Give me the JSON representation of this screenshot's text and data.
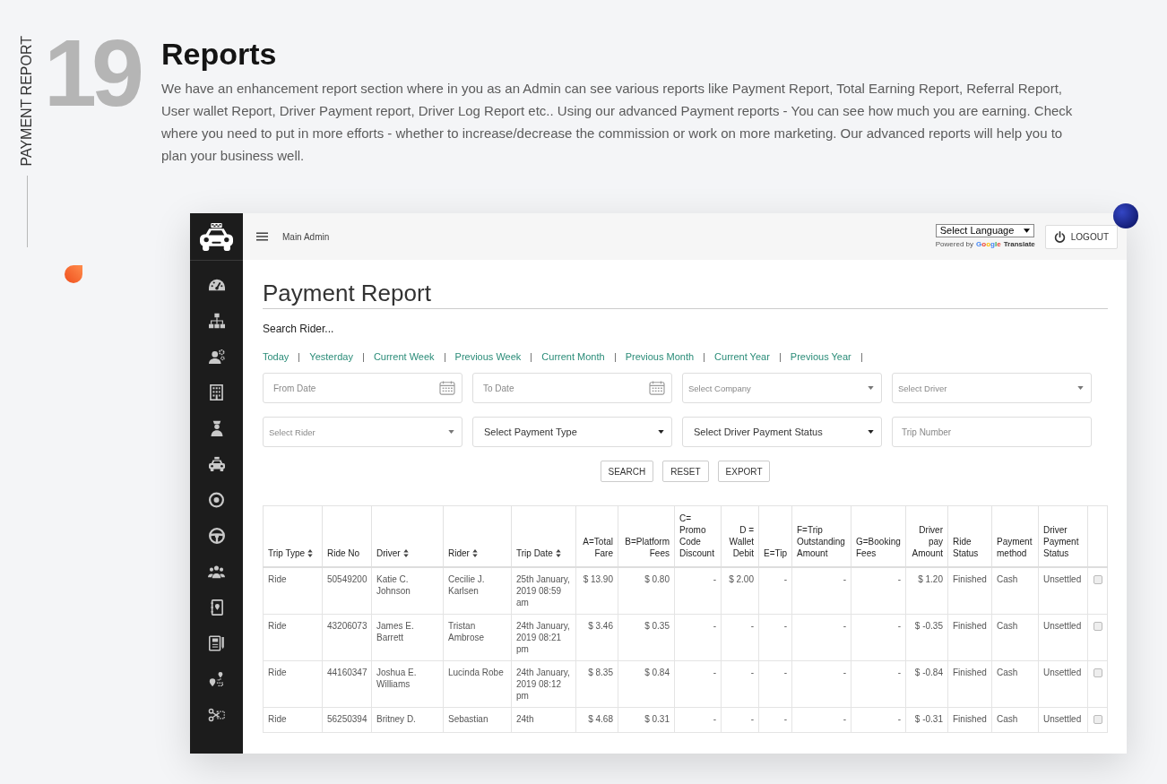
{
  "side_label": "PAYMENT REPORT",
  "section_number": "19",
  "title": "Reports",
  "description": "We have an enhancement report section where in you as an Admin can see various reports like Payment Report, Total Earning Report, Referral Report, User wallet Report, Driver Payment report, Driver Log Report etc.. Using our advanced Payment reports - You can see how much you are earning. Check where you need to put in more efforts - whether to increase/decrease the commission or work on more marketing. Our advanced reports will help you to plan your business well.",
  "app": {
    "topbar": {
      "user": "Main Admin",
      "language_select": "Select Language",
      "powered_by": "Powered by",
      "google": "Google",
      "translate": "Translate",
      "logout": "LOGOUT"
    },
    "page_title": "Payment Report",
    "search_label": "Search Rider...",
    "date_ranges": [
      "Today",
      "Yesterday",
      "Current Week",
      "Previous Week",
      "Current Month",
      "Previous Month",
      "Current Year",
      "Previous Year"
    ],
    "filters": [
      [
        {
          "kind": "date",
          "placeholder": "From Date"
        },
        {
          "kind": "date",
          "placeholder": "To Date"
        },
        {
          "kind": "select",
          "placeholder": "Select Company"
        },
        {
          "kind": "select",
          "placeholder": "Select Driver"
        }
      ],
      [
        {
          "kind": "select",
          "placeholder": "Select Rider"
        },
        {
          "kind": "select",
          "value": "Select Payment Type"
        },
        {
          "kind": "select",
          "value": "Select Driver Payment Status"
        },
        {
          "kind": "text",
          "placeholder": "Trip Number"
        }
      ]
    ],
    "buttons": [
      "SEARCH",
      "RESET",
      "EXPORT"
    ],
    "table": {
      "columns": [
        {
          "label": "Trip Type",
          "kind": "text",
          "sortable": true
        },
        {
          "label": "Ride No",
          "kind": "text",
          "sortable": false
        },
        {
          "label": "Driver",
          "kind": "text",
          "sortable": true
        },
        {
          "label": "Rider",
          "kind": "text",
          "sortable": true
        },
        {
          "label": "Trip Date",
          "kind": "text",
          "sortable": true
        },
        {
          "label": "A=Total Fare",
          "kind": "amount",
          "sortable": false
        },
        {
          "label": "B=Platform Fees",
          "kind": "amount",
          "sortable": false
        },
        {
          "label": "C= Promo Code Discount",
          "kind": "charge",
          "sortable": false
        },
        {
          "label": "D = Wallet Debit",
          "kind": "amount",
          "sortable": false
        },
        {
          "label": "E=Tip",
          "kind": "charge",
          "sortable": false
        },
        {
          "label": "F=Trip Outstanding Amount",
          "kind": "charge",
          "sortable": false
        },
        {
          "label": "G=Booking Fees",
          "kind": "charge",
          "sortable": false
        },
        {
          "label": "Driver pay Amount",
          "kind": "amount",
          "sortable": false
        },
        {
          "label": "Ride Status",
          "kind": "text",
          "sortable": false
        },
        {
          "label": "Payment method",
          "kind": "text",
          "sortable": false
        },
        {
          "label": "Driver Payment Status",
          "kind": "text",
          "sortable": false
        },
        {
          "kind": "check"
        }
      ],
      "rows": [
        {
          "cells": [
            "Ride",
            "50549200",
            "Katie C. Johnson",
            "Cecilie J. Karlsen",
            "25th January, 2019 08:59 am",
            "$ 13.90",
            "$ 0.80",
            "-",
            "$ 2.00",
            "-",
            "-",
            "-",
            "$ 1.20",
            "Finished",
            "Cash",
            "Unsettled"
          ],
          "checked": false
        },
        {
          "cells": [
            "Ride",
            "43206073",
            "James E. Barrett",
            "Tristan Ambrose",
            "24th January, 2019 08:21 pm",
            "$ 3.46",
            "$ 0.35",
            "-",
            "-",
            "-",
            "-",
            "-",
            "$ -0.35",
            "Finished",
            "Cash",
            "Unsettled"
          ],
          "checked": false
        },
        {
          "cells": [
            "Ride",
            "44160347",
            "Joshua E. Williams",
            "Lucinda Robe",
            "24th January, 2019 08:12 pm",
            "$ 8.35",
            "$ 0.84",
            "-",
            "-",
            "-",
            "-",
            "-",
            "$ -0.84",
            "Finished",
            "Cash",
            "Unsettled"
          ],
          "checked": false
        },
        {
          "cells": [
            "Ride",
            "56250394",
            "Britney D.",
            "Sebastian",
            "24th",
            "$ 4.68",
            "$ 0.31",
            "-",
            "-",
            "-",
            "-",
            "-",
            "$ -0.31",
            "Finished",
            "Cash",
            "Unsettled"
          ],
          "checked": false
        }
      ]
    }
  }
}
